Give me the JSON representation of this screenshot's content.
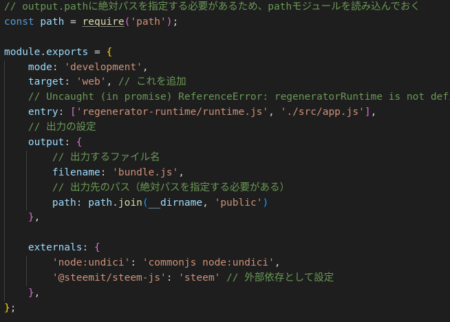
{
  "editor": {
    "language": "javascript",
    "theme_background": "#1e1e1e",
    "colors": {
      "comment": "#6a9955",
      "keyword": "#569cd6",
      "variable": "#9cdcfe",
      "function": "#dcdcaa",
      "string": "#ce9178",
      "bracket_level1": "#ffd700",
      "bracket_level2": "#da70d6",
      "bracket_level3": "#179fff"
    },
    "lines": [
      [
        {
          "t": "comment",
          "v": "// output.pathに絶対パスを指定する必要があるため、pathモジュールを読み込んでおく"
        }
      ],
      [
        {
          "t": "keyword",
          "v": "const"
        },
        {
          "t": "ws",
          "v": " "
        },
        {
          "t": "var",
          "v": "path"
        },
        {
          "t": "punct",
          "v": " = "
        },
        {
          "t": "func",
          "v": "require",
          "u": true
        },
        {
          "t": "brace-p",
          "v": "("
        },
        {
          "t": "string",
          "v": "'path'"
        },
        {
          "t": "brace-p",
          "v": ")"
        },
        {
          "t": "punct",
          "v": ";"
        }
      ],
      [],
      [
        {
          "t": "var",
          "v": "module"
        },
        {
          "t": "punct",
          "v": "."
        },
        {
          "t": "var",
          "v": "exports"
        },
        {
          "t": "punct",
          "v": " = "
        },
        {
          "t": "brace-y",
          "v": "{"
        }
      ],
      [
        {
          "t": "ws",
          "v": "    "
        },
        {
          "t": "var",
          "v": "mode"
        },
        {
          "t": "punct",
          "v": ": "
        },
        {
          "t": "string",
          "v": "'development'"
        },
        {
          "t": "punct",
          "v": ","
        }
      ],
      [
        {
          "t": "ws",
          "v": "    "
        },
        {
          "t": "var",
          "v": "target"
        },
        {
          "t": "punct",
          "v": ": "
        },
        {
          "t": "string",
          "v": "'web'"
        },
        {
          "t": "punct",
          "v": ", "
        },
        {
          "t": "comment",
          "v": "// これを追加"
        }
      ],
      [
        {
          "t": "ws",
          "v": "    "
        },
        {
          "t": "comment",
          "v": "// Uncaught (in promise) ReferenceError: regeneratorRuntime is not defined"
        }
      ],
      [
        {
          "t": "ws",
          "v": "    "
        },
        {
          "t": "var",
          "v": "entry"
        },
        {
          "t": "punct",
          "v": ": "
        },
        {
          "t": "brace-p",
          "v": "["
        },
        {
          "t": "string",
          "v": "'regenerator-runtime/runtime.js'"
        },
        {
          "t": "punct",
          "v": ", "
        },
        {
          "t": "string",
          "v": "'./src/app.js'"
        },
        {
          "t": "brace-p",
          "v": "]"
        },
        {
          "t": "punct",
          "v": ","
        }
      ],
      [
        {
          "t": "ws",
          "v": "    "
        },
        {
          "t": "comment",
          "v": "// 出力の設定"
        }
      ],
      [
        {
          "t": "ws",
          "v": "    "
        },
        {
          "t": "var",
          "v": "output"
        },
        {
          "t": "punct",
          "v": ": "
        },
        {
          "t": "brace-p",
          "v": "{"
        }
      ],
      [
        {
          "t": "ws",
          "v": "        "
        },
        {
          "t": "comment",
          "v": "// 出力するファイル名"
        }
      ],
      [
        {
          "t": "ws",
          "v": "        "
        },
        {
          "t": "var",
          "v": "filename"
        },
        {
          "t": "punct",
          "v": ": "
        },
        {
          "t": "string",
          "v": "'bundle.js'"
        },
        {
          "t": "punct",
          "v": ","
        }
      ],
      [
        {
          "t": "ws",
          "v": "        "
        },
        {
          "t": "comment",
          "v": "// 出力先のパス（絶対パスを指定する必要がある）"
        }
      ],
      [
        {
          "t": "ws",
          "v": "        "
        },
        {
          "t": "var",
          "v": "path"
        },
        {
          "t": "punct",
          "v": ": "
        },
        {
          "t": "var",
          "v": "path"
        },
        {
          "t": "punct",
          "v": "."
        },
        {
          "t": "func",
          "v": "join"
        },
        {
          "t": "brace-b",
          "v": "("
        },
        {
          "t": "var",
          "v": "__dirname"
        },
        {
          "t": "punct",
          "v": ", "
        },
        {
          "t": "string",
          "v": "'public'"
        },
        {
          "t": "brace-b",
          "v": ")"
        }
      ],
      [
        {
          "t": "ws",
          "v": "    "
        },
        {
          "t": "brace-p",
          "v": "}"
        },
        {
          "t": "punct",
          "v": ","
        }
      ],
      [],
      [
        {
          "t": "ws",
          "v": "    "
        },
        {
          "t": "var",
          "v": "externals"
        },
        {
          "t": "punct",
          "v": ": "
        },
        {
          "t": "brace-p",
          "v": "{"
        }
      ],
      [
        {
          "t": "ws",
          "v": "        "
        },
        {
          "t": "string",
          "v": "'node:undici'"
        },
        {
          "t": "punct",
          "v": ": "
        },
        {
          "t": "string",
          "v": "'commonjs node:undici'"
        },
        {
          "t": "punct",
          "v": ","
        }
      ],
      [
        {
          "t": "ws",
          "v": "        "
        },
        {
          "t": "string",
          "v": "'@steemit/steem-js'"
        },
        {
          "t": "punct",
          "v": ": "
        },
        {
          "t": "string",
          "v": "'steem'"
        },
        {
          "t": "punct",
          "v": " "
        },
        {
          "t": "comment",
          "v": "// 外部依存として設定"
        }
      ],
      [
        {
          "t": "ws",
          "v": "    "
        },
        {
          "t": "brace-p",
          "v": "}"
        },
        {
          "t": "punct",
          "v": ","
        }
      ],
      [
        {
          "t": "brace-y",
          "v": "}"
        },
        {
          "t": "punct",
          "v": ";"
        }
      ]
    ]
  }
}
